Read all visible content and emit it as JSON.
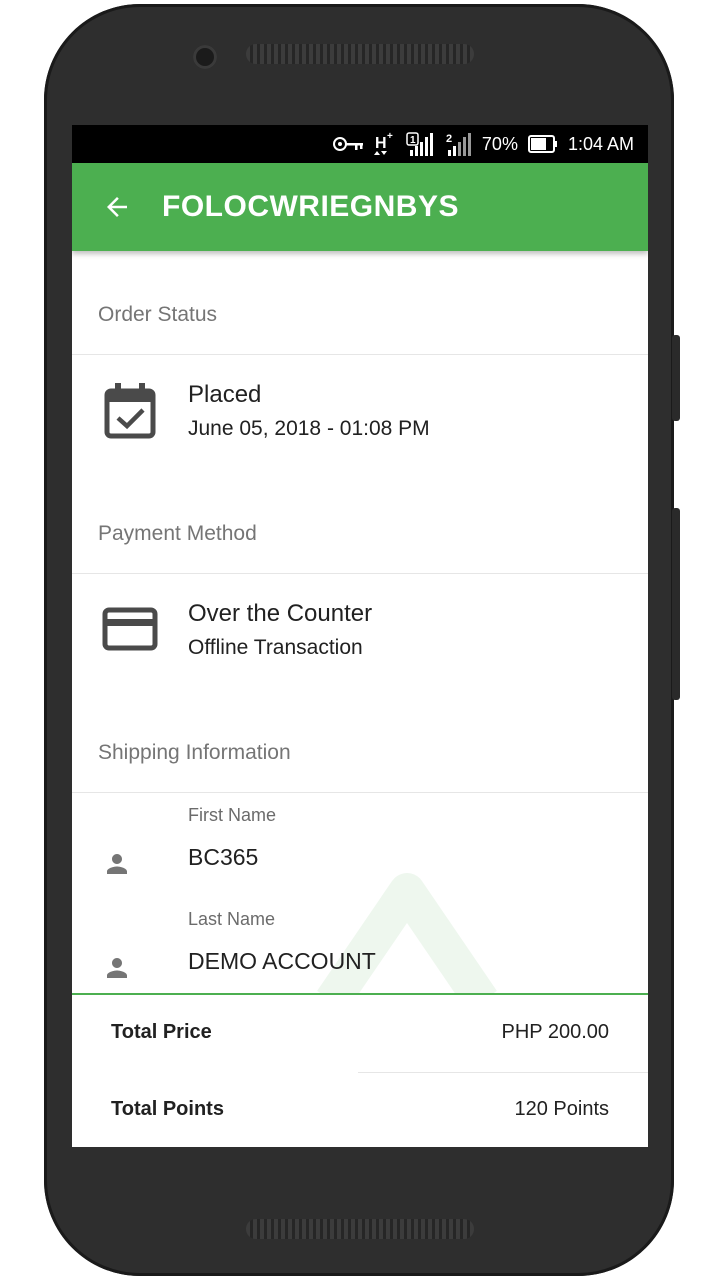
{
  "status_bar": {
    "battery": "70%",
    "time": "1:04 AM",
    "icons": [
      "vpn-key-icon",
      "h-plus-signal-icon",
      "sim1-signal-icon",
      "sim2-signal-icon",
      "battery-icon"
    ]
  },
  "app_bar": {
    "back_icon": "arrow-back-icon",
    "title": "FOLOCWRIEGNBYS",
    "color": "#4caf50"
  },
  "order_status": {
    "header": "Order Status",
    "icon": "calendar-check-icon",
    "status": "Placed",
    "date": "June 05, 2018 - 01:08 PM"
  },
  "payment": {
    "header": "Payment Method",
    "icon": "credit-card-icon",
    "method": "Over the Counter",
    "detail": "Offline Transaction"
  },
  "shipping": {
    "header": "Shipping Information",
    "fields": [
      {
        "label": "First Name",
        "value": "BC365",
        "icon": "person-icon"
      },
      {
        "label": "Last Name",
        "value": "DEMO ACCOUNT",
        "icon": "person-icon"
      }
    ]
  },
  "totals": {
    "price_label": "Total Price",
    "price_value": "PHP 200.00",
    "points_label": "Total Points",
    "points_value": "120 Points"
  }
}
